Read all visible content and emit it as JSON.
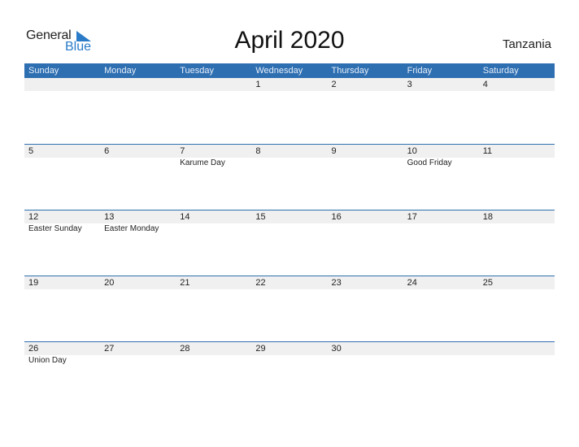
{
  "brand": {
    "word1": "General",
    "word2": "Blue",
    "color": "#2a7bc8"
  },
  "title": "April 2020",
  "country": "Tanzania",
  "colors": {
    "header_bg": "#2e6fb2",
    "date_band": "#f0f0f0"
  },
  "weekdays": [
    "Sunday",
    "Monday",
    "Tuesday",
    "Wednesday",
    "Thursday",
    "Friday",
    "Saturday"
  ],
  "weeks": [
    {
      "days": [
        "",
        "",
        "",
        "1",
        "2",
        "3",
        "4"
      ],
      "holidays": [
        "",
        "",
        "",
        "",
        "",
        "",
        ""
      ]
    },
    {
      "days": [
        "5",
        "6",
        "7",
        "8",
        "9",
        "10",
        "11"
      ],
      "holidays": [
        "",
        "",
        "Karume Day",
        "",
        "",
        "Good Friday",
        ""
      ]
    },
    {
      "days": [
        "12",
        "13",
        "14",
        "15",
        "16",
        "17",
        "18"
      ],
      "holidays": [
        "Easter Sunday",
        "Easter Monday",
        "",
        "",
        "",
        "",
        ""
      ]
    },
    {
      "days": [
        "19",
        "20",
        "21",
        "22",
        "23",
        "24",
        "25"
      ],
      "holidays": [
        "",
        "",
        "",
        "",
        "",
        "",
        ""
      ]
    },
    {
      "days": [
        "26",
        "27",
        "28",
        "29",
        "30",
        "",
        ""
      ],
      "holidays": [
        "Union Day",
        "",
        "",
        "",
        "",
        "",
        ""
      ]
    }
  ]
}
